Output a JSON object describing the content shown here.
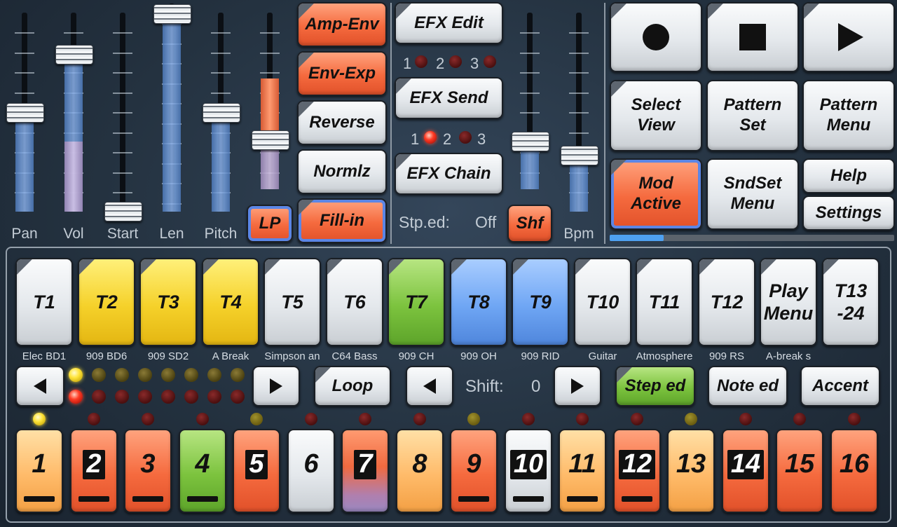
{
  "faders": [
    {
      "id": "pan",
      "label": "Pan"
    },
    {
      "id": "vol",
      "label": "Vol"
    },
    {
      "id": "start",
      "label": "Start"
    },
    {
      "id": "len",
      "label": "Len"
    },
    {
      "id": "pitch",
      "label": "Pitch"
    },
    {
      "id": "filter",
      "label": ""
    },
    {
      "id": "efx",
      "label": ""
    },
    {
      "id": "bpm",
      "label": "Bpm"
    }
  ],
  "left_buttons": {
    "amp_env": "Amp-Env",
    "env_exp": "Env-Exp",
    "reverse": "Reverse",
    "normlz": "Normlz",
    "fill_in": "Fill-in",
    "lp": "LP"
  },
  "efx": {
    "edit": "EFX Edit",
    "send": "EFX Send",
    "chain": "EFX Chain",
    "row1": [
      "1",
      "2",
      "3"
    ],
    "row2": [
      "1",
      "2",
      "3"
    ],
    "step_ed_label": "Stp.ed:",
    "step_ed_value": "Off",
    "shf": "Shf"
  },
  "transport": {
    "record_icon": "record-icon",
    "stop_icon": "stop-icon",
    "play_icon": "play-icon"
  },
  "menu": {
    "select_view": [
      "Select",
      "View"
    ],
    "pattern_set": [
      "Pattern",
      "Set"
    ],
    "pattern_menu": [
      "Pattern",
      "Menu"
    ],
    "mod_active": [
      "Mod",
      "Active"
    ],
    "sndset_menu": [
      "SndSet",
      "Menu"
    ],
    "help": "Help",
    "settings": "Settings"
  },
  "progress": 0.19,
  "tracks": [
    {
      "label": "T1",
      "sound": "Elec BD1",
      "color": "white"
    },
    {
      "label": "T2",
      "sound": "909 BD6",
      "color": "yellow"
    },
    {
      "label": "T3",
      "sound": "909 SD2",
      "color": "yellow"
    },
    {
      "label": "T4",
      "sound": "A Break",
      "color": "yellow"
    },
    {
      "label": "T5",
      "sound": "Simpson an",
      "color": "white"
    },
    {
      "label": "T6",
      "sound": "C64 Bass",
      "color": "white"
    },
    {
      "label": "T7",
      "sound": "909 CH",
      "color": "green"
    },
    {
      "label": "T8",
      "sound": "909 OH",
      "color": "blue"
    },
    {
      "label": "T9",
      "sound": "909 RID",
      "color": "blue"
    },
    {
      "label": "T10",
      "sound": "Guitar",
      "color": "white"
    },
    {
      "label": "T11",
      "sound": "Atmosphere",
      "color": "white"
    },
    {
      "label": "T12",
      "sound": "909 RS",
      "color": "white"
    },
    {
      "label": [
        "Play",
        "Menu"
      ],
      "sound": "A-break s",
      "color": "white"
    },
    {
      "label": [
        "T13",
        "-24"
      ],
      "sound": "",
      "color": "white"
    }
  ],
  "controls": {
    "loop": "Loop",
    "shift_label": "Shift:",
    "shift_value": "0",
    "step_ed": "Step ed",
    "note_ed": "Note ed",
    "accent": "Accent"
  },
  "steps": [
    {
      "n": "1",
      "color": "lightorange",
      "black": false,
      "bar": true,
      "led": "yel-on"
    },
    {
      "n": "2",
      "color": "orange",
      "black": true,
      "bar": true,
      "led": "red-off"
    },
    {
      "n": "3",
      "color": "orange",
      "black": false,
      "bar": true,
      "led": "red-off"
    },
    {
      "n": "4",
      "color": "green",
      "black": false,
      "bar": true,
      "led": "red-off"
    },
    {
      "n": "5",
      "color": "orange",
      "black": true,
      "bar": false,
      "led": "yel-dim"
    },
    {
      "n": "6",
      "color": "white",
      "black": false,
      "bar": false,
      "led": "red-off"
    },
    {
      "n": "7",
      "color": "purple",
      "black": true,
      "bar": false,
      "led": "red-off"
    },
    {
      "n": "8",
      "color": "lightorange",
      "black": false,
      "bar": false,
      "led": "red-off"
    },
    {
      "n": "9",
      "color": "orange",
      "black": false,
      "bar": true,
      "led": "yel-dim"
    },
    {
      "n": "10",
      "color": "white",
      "black": true,
      "bar": true,
      "led": "red-off"
    },
    {
      "n": "11",
      "color": "lightorange",
      "black": false,
      "bar": true,
      "led": "red-off"
    },
    {
      "n": "12",
      "color": "orange",
      "black": true,
      "bar": true,
      "led": "red-off"
    },
    {
      "n": "13",
      "color": "lightorange",
      "black": false,
      "bar": false,
      "led": "yel-dim"
    },
    {
      "n": "14",
      "color": "orange",
      "black": true,
      "bar": false,
      "led": "red-off"
    },
    {
      "n": "15",
      "color": "orange",
      "black": false,
      "bar": false,
      "led": "red-off"
    },
    {
      "n": "16",
      "color": "orange",
      "black": false,
      "bar": false,
      "led": "red-off"
    }
  ]
}
